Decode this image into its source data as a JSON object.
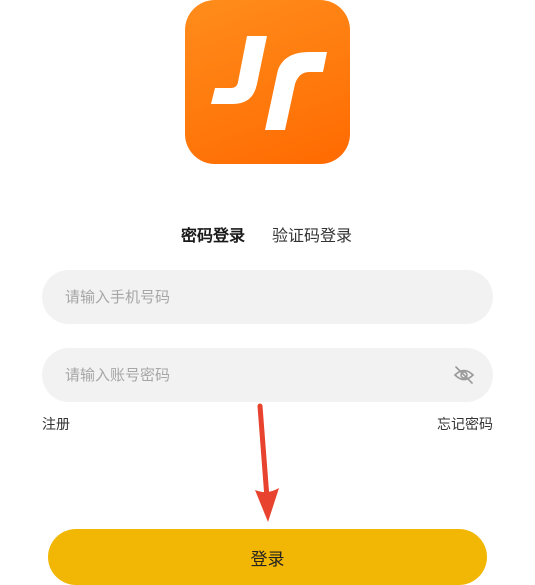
{
  "app": {
    "logo_text": "Jr",
    "brand_color": "#ff6a00",
    "accent_color": "#f2b705"
  },
  "tabs": [
    {
      "label": "密码登录",
      "active": true
    },
    {
      "label": "验证码登录",
      "active": false
    }
  ],
  "form": {
    "phone": {
      "placeholder": "请输入手机号码",
      "value": ""
    },
    "password": {
      "placeholder": "请输入账号密码",
      "value": ""
    },
    "password_toggle_icon": "eye-slash-icon"
  },
  "links": {
    "register": "注册",
    "forgot_password": "忘记密码"
  },
  "login_button": {
    "label": "登录"
  },
  "annotation": {
    "arrow_color": "#e8432e"
  }
}
